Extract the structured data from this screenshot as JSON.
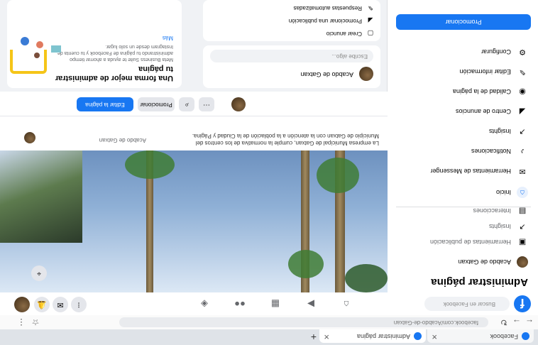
{
  "browser": {
    "tabs": [
      {
        "title": "Facebook",
        "color": "#1877f2"
      },
      {
        "title": "Administrar página",
        "color": "#1877f2"
      }
    ],
    "url": "facebook.com/Acabdo-de-Gatxan",
    "new_tab": "+"
  },
  "fbnav": {
    "logo": "f",
    "search_placeholder": "Buscar en Facebook",
    "nav_icons": [
      "home-icon",
      "video-icon",
      "store-icon",
      "groups-icon",
      "gaming-icon"
    ],
    "right_icons": [
      "menu-icon",
      "messenger-icon",
      "notifications-icon"
    ],
    "badges": [
      "2",
      "1"
    ]
  },
  "sidebar": {
    "title": "Administrar página",
    "page_name": "Acabdo de Gatxan",
    "items": [
      {
        "icon": "home-icon",
        "label": "Inicio"
      },
      {
        "icon": "messenger-icon",
        "label": "Herramientas de Messenger"
      },
      {
        "icon": "bell-icon",
        "label": "Notificaciones"
      },
      {
        "icon": "insights-icon",
        "label": "Insights"
      },
      {
        "icon": "megaphone-icon",
        "label": "Centro de anuncios"
      },
      {
        "icon": "quality-icon",
        "label": "Calidad de la página"
      },
      {
        "icon": "pencil-icon",
        "label": "Editar información"
      },
      {
        "icon": "gear-icon",
        "label": "Configurar"
      }
    ],
    "sub_items": [
      {
        "icon": "briefcase-icon",
        "label": "Herramientas de publicación"
      },
      {
        "icon": "chart-icon",
        "label": "Insights"
      },
      {
        "icon": "calendar-icon",
        "label": "Interacciones"
      }
    ],
    "promote_label": "Promocionar"
  },
  "header": {
    "page_name": "Acabdo de Gatxan",
    "description": "La empresa Municipal de Gatxan, cumple la normativa de los centros del Municipio de Gatxan con la atención a la población de la Ciudad y Página.",
    "edit_button": "Editar la página",
    "promote_button": "Promocionar"
  },
  "main": {
    "create_post": {
      "name": "Acabdo de Gatxan",
      "placeholder": "Escribe algo..."
    },
    "manage_card": {
      "title": "Una forma mejor de administrar tu página",
      "text": "Meta Business Suite te ayuda a ahorrar tiempo administrando tu página de Facebook y tu cuenta de Instagram desde un solo lugar.",
      "link": "Más"
    },
    "actions": [
      {
        "icon": "ad-icon",
        "label": "Crear anuncio"
      },
      {
        "icon": "boost-icon",
        "label": "Promocionar una publicación"
      },
      {
        "icon": "automation-icon",
        "label": "Respuestas automatizadas"
      }
    ]
  }
}
